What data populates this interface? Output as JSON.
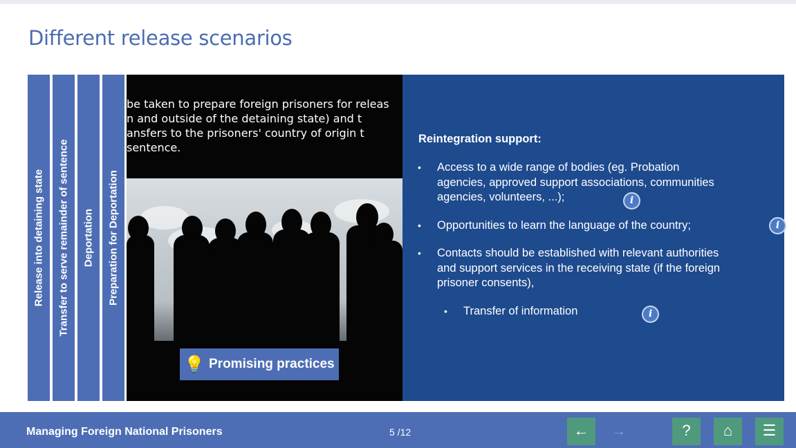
{
  "slide_title": "Different release scenarios",
  "tabs": [
    {
      "label": "Release into detaining state"
    },
    {
      "label": "Transfer to serve remainder of sentence"
    },
    {
      "label": "Deportation"
    },
    {
      "label": "Preparation for Deportation"
    }
  ],
  "photo_text": {
    "line1": "be taken to prepare foreign prisoners for releas",
    "line2": "n and outside of the detaining state) and t",
    "line3": "ansfers to the prisoners' country of origin t",
    "line4": "sentence."
  },
  "promising_button": {
    "icon": "lightbulb-icon",
    "label": "Promising practices"
  },
  "panel": {
    "title": "Reintegration support:",
    "bullets": [
      {
        "line1": "Access to a wide range of bodies (eg. Probation",
        "line2": "agencies, approved support associations, communities",
        "line3": "agencies, volunteers, ...);"
      },
      {
        "line1": "Opportunities to learn the language of the country;"
      },
      {
        "line1": "Contacts should be established with relevant authorities",
        "line2": "and support services in the receiving state (if the foreign",
        "line3": "prisoner consents),"
      },
      {
        "line1": "Transfer of information"
      }
    ],
    "bullet_glyph": "•",
    "info_glyph": "i"
  },
  "footer": {
    "course_title": "Managing Foreign National Prisoners",
    "page": "5 /12",
    "prev_glyph": "←",
    "next_glyph": "→",
    "help_glyph": "?",
    "home_glyph": "⌂",
    "menu_glyph": "☰"
  },
  "colors": {
    "accent": "#4d6eb4",
    "panel": "#1e4a8e",
    "nav_button": "#4f9a7d",
    "title": "#4a6cb3"
  }
}
